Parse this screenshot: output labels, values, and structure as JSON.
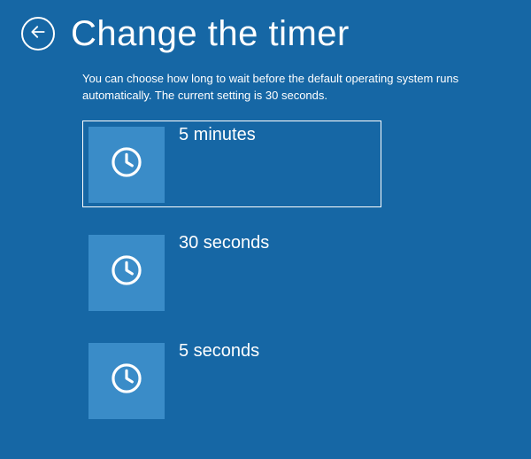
{
  "header": {
    "title": "Change the timer"
  },
  "description": "You can choose how long to wait before the default operating system runs automatically. The current setting is 30 seconds.",
  "options": [
    {
      "label": "5 minutes",
      "selected": true
    },
    {
      "label": "30 seconds",
      "selected": false
    },
    {
      "label": "5 seconds",
      "selected": false
    }
  ]
}
